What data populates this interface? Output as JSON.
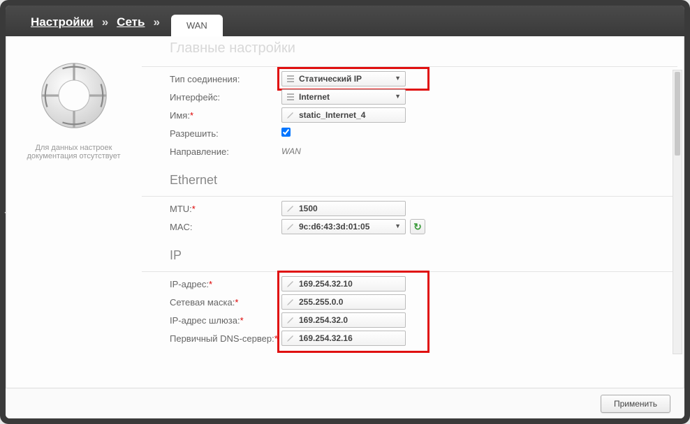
{
  "breadcrumb": {
    "settings": "Настройки",
    "network": "Сеть",
    "tab_wan": "WAN"
  },
  "sidebar": {
    "help_text": "Для данных настроек документация отсутствует"
  },
  "sections": {
    "main": "Главные настройки",
    "ethernet": "Ethernet",
    "ip": "IP"
  },
  "fields": {
    "conn_type": {
      "label": "Тип соединения:",
      "value": "Статический IP"
    },
    "interface": {
      "label": "Интерфейс:",
      "value": "Internet"
    },
    "name": {
      "label": "Имя:",
      "value": "static_Internet_4"
    },
    "allow": {
      "label": "Разрешить:"
    },
    "direction": {
      "label": "Направление:",
      "value": "WAN"
    },
    "mtu": {
      "label": "MTU:",
      "value": "1500"
    },
    "mac": {
      "label": "MAC:",
      "value": "9c:d6:43:3d:01:05"
    },
    "ip_addr": {
      "label": "IP-адрес:",
      "value": "169.254.32.10"
    },
    "netmask": {
      "label": "Сетевая маска:",
      "value": "255.255.0.0"
    },
    "gateway": {
      "label": "IP-адрес шлюза:",
      "value": "169.254.32.0"
    },
    "dns1": {
      "label": "Первичный DNS-сервер:",
      "value": "169.254.32.16"
    }
  },
  "buttons": {
    "apply": "Применить"
  }
}
